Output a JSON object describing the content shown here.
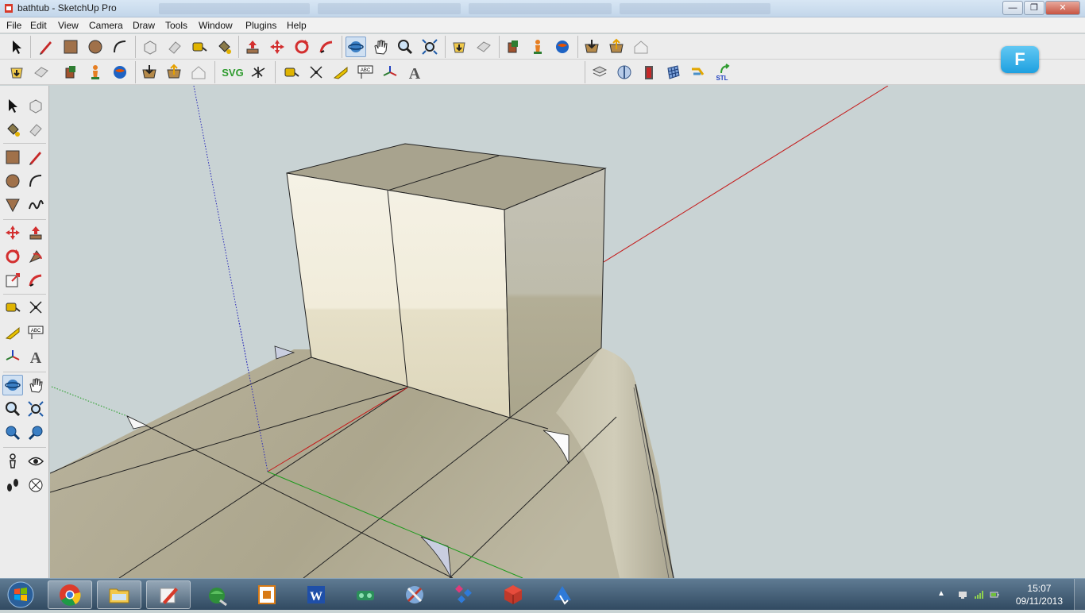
{
  "window": {
    "title": "bathtub - SketchUp Pro",
    "controls": {
      "minimize": "—",
      "maximize": "❐",
      "close": "✕"
    }
  },
  "menu": [
    "File",
    "Edit",
    "View",
    "Camera",
    "Draw",
    "Tools",
    "Window",
    "Plugins",
    "Help"
  ],
  "toolbars": {
    "svg_label": "SVG",
    "stl_label": "STL",
    "text_label": "ABC"
  },
  "left_toolbar": {
    "tools": [
      "select",
      "make-component",
      "paint-bucket",
      "eraser",
      "rectangle",
      "line",
      "circle",
      "arc",
      "polygon",
      "freehand",
      "move",
      "push-pull",
      "rotate",
      "follow-me",
      "scale",
      "offset",
      "tape-measure",
      "dimension",
      "protractor",
      "text",
      "axes",
      "3d-text",
      "orbit",
      "pan",
      "zoom",
      "zoom-window",
      "previous",
      "next",
      "position-camera",
      "look-around",
      "walk",
      "section-plane"
    ]
  },
  "badge": {
    "letter": "F"
  },
  "taskbar": {
    "time": "15:07",
    "date": "09/11/2013",
    "apps": [
      "chrome",
      "file-explorer",
      "sketchup",
      "google-earth",
      "powerpoint",
      "word",
      "app-green",
      "app-blue",
      "app-gems",
      "app-red-cube",
      "app-blue-arrow"
    ]
  },
  "colors": {
    "viewport_bg": "#c9d3d4",
    "model_top": "#a8a38e",
    "model_front_light": "#f3efdf",
    "model_front_shadow": "#e2dcc2",
    "model_side": "#bdbbad",
    "axis_red": "#c41a1a",
    "axis_green": "#1b9a1b",
    "axis_blue": "#2b2bb8"
  }
}
